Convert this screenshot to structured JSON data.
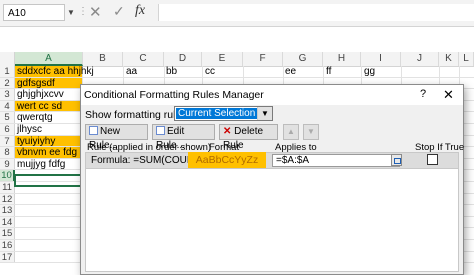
{
  "formula_bar": {
    "name_box": "A10",
    "separator": "⋮",
    "cancel_icon": "✕",
    "enter_icon": "✓",
    "fx_label": "fx",
    "formula": ""
  },
  "columns": [
    "A",
    "B",
    "C",
    "D",
    "E",
    "F",
    "G",
    "H",
    "I",
    "J",
    "K",
    "L"
  ],
  "rows": [
    {
      "num": "1",
      "a": "sddxcfc aa hhjhkj",
      "hl": true
    },
    {
      "num": "2",
      "a": "gdfsgsdf",
      "hl": true
    },
    {
      "num": "3",
      "a": "ghjghjxcvv",
      "hl": false
    },
    {
      "num": "4",
      "a": "wert cc sd",
      "hl": true
    },
    {
      "num": "5",
      "a": "qwerqtg",
      "hl": false
    },
    {
      "num": "6",
      "a": "jlhysc",
      "hl": false
    },
    {
      "num": "7",
      "a": "tyuiyiyhy",
      "hl": true
    },
    {
      "num": "8",
      "a": "vbnvm ee fdg",
      "hl": true
    },
    {
      "num": "9",
      "a": "mujjyg fdfg",
      "hl": false
    },
    {
      "num": "10",
      "a": "",
      "hl": false
    },
    {
      "num": "11",
      "a": "",
      "hl": false
    },
    {
      "num": "12",
      "a": "",
      "hl": false
    },
    {
      "num": "13",
      "a": "",
      "hl": false
    },
    {
      "num": "14",
      "a": "",
      "hl": false
    },
    {
      "num": "15",
      "a": "",
      "hl": false
    },
    {
      "num": "16",
      "a": "",
      "hl": false
    },
    {
      "num": "17",
      "a": "",
      "hl": false
    }
  ],
  "row1_cells": {
    "c": "aa",
    "d": "bb",
    "e": "cc",
    "g": "ee",
    "h": "ff",
    "i": "gg"
  },
  "dialog": {
    "title": "Conditional Formatting Rules Manager",
    "help": "?",
    "close": "✕",
    "show_label": "Show formatting rules for:",
    "show_value": "Current Selection",
    "new_rule": "New Rule...",
    "edit_rule": "Edit Rule...",
    "delete_rule": "Delete Rule",
    "move_up": "▲",
    "move_down": "▼",
    "headers": {
      "rule": "Rule (applied in order shown)",
      "format": "Format",
      "applies_to": "Applies to",
      "stop_if_true": "Stop If True"
    },
    "rule_row": {
      "rule": "Formula: =SUM(COUNTI...",
      "format_preview": "AaBbCcYyZz",
      "applies_to": "=$A:$A",
      "stop_if_true": false
    }
  },
  "colors": {
    "highlight": "#ffc000",
    "excel_green": "#217346",
    "selection_blue": "#0078d7"
  }
}
